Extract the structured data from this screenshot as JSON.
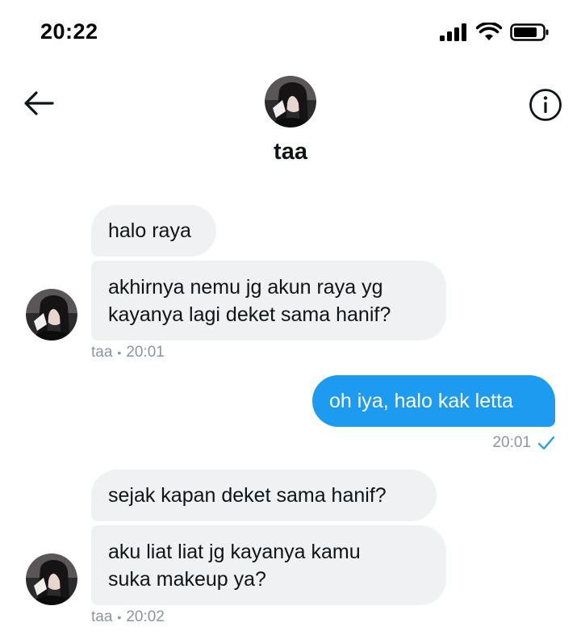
{
  "status_bar": {
    "time": "20:22"
  },
  "header": {
    "name": "taa"
  },
  "messages": {
    "m1": "halo raya",
    "m2": "akhirnya nemu jg akun raya yg\nkayanya lagi deket sama hanif?",
    "m2_sender": "taa",
    "m2_time": "20:01",
    "m3": "oh iya, halo kak letta",
    "m3_time": "20:01",
    "m4": "sejak kapan deket sama hanif?",
    "m5": "aku liat liat jg kayanya kamu\nsuka makeup ya?",
    "m5_sender": "taa",
    "m5_time": "20:02",
    "meta_separator": "•"
  },
  "icons": {
    "back": "arrow-left-icon",
    "info": "info-icon",
    "signal": "cellular-signal-icon",
    "wifi": "wifi-icon",
    "battery": "battery-icon",
    "read": "check-icon"
  },
  "colors": {
    "outgoing_bubble": "#1d9bf0",
    "incoming_bubble": "#eff1f3",
    "meta_text": "#8b969e",
    "check": "#1d9bf0"
  }
}
